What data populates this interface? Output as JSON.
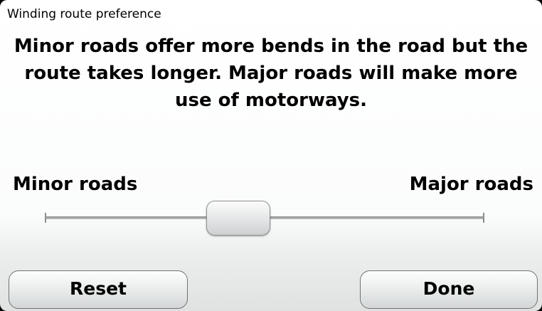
{
  "screen": {
    "title": "Winding route preference",
    "message": "Minor roads offer more bends in the road but the route takes longer. Major roads will make more use of motorways."
  },
  "slider": {
    "min_label": "Minor roads",
    "max_label": "Major roads",
    "value_fraction": 0.44
  },
  "buttons": {
    "reset_label": "Reset",
    "done_label": "Done"
  },
  "colors": {
    "text": "#000000",
    "background": "#ffffff",
    "track": "#9a9c9d"
  }
}
